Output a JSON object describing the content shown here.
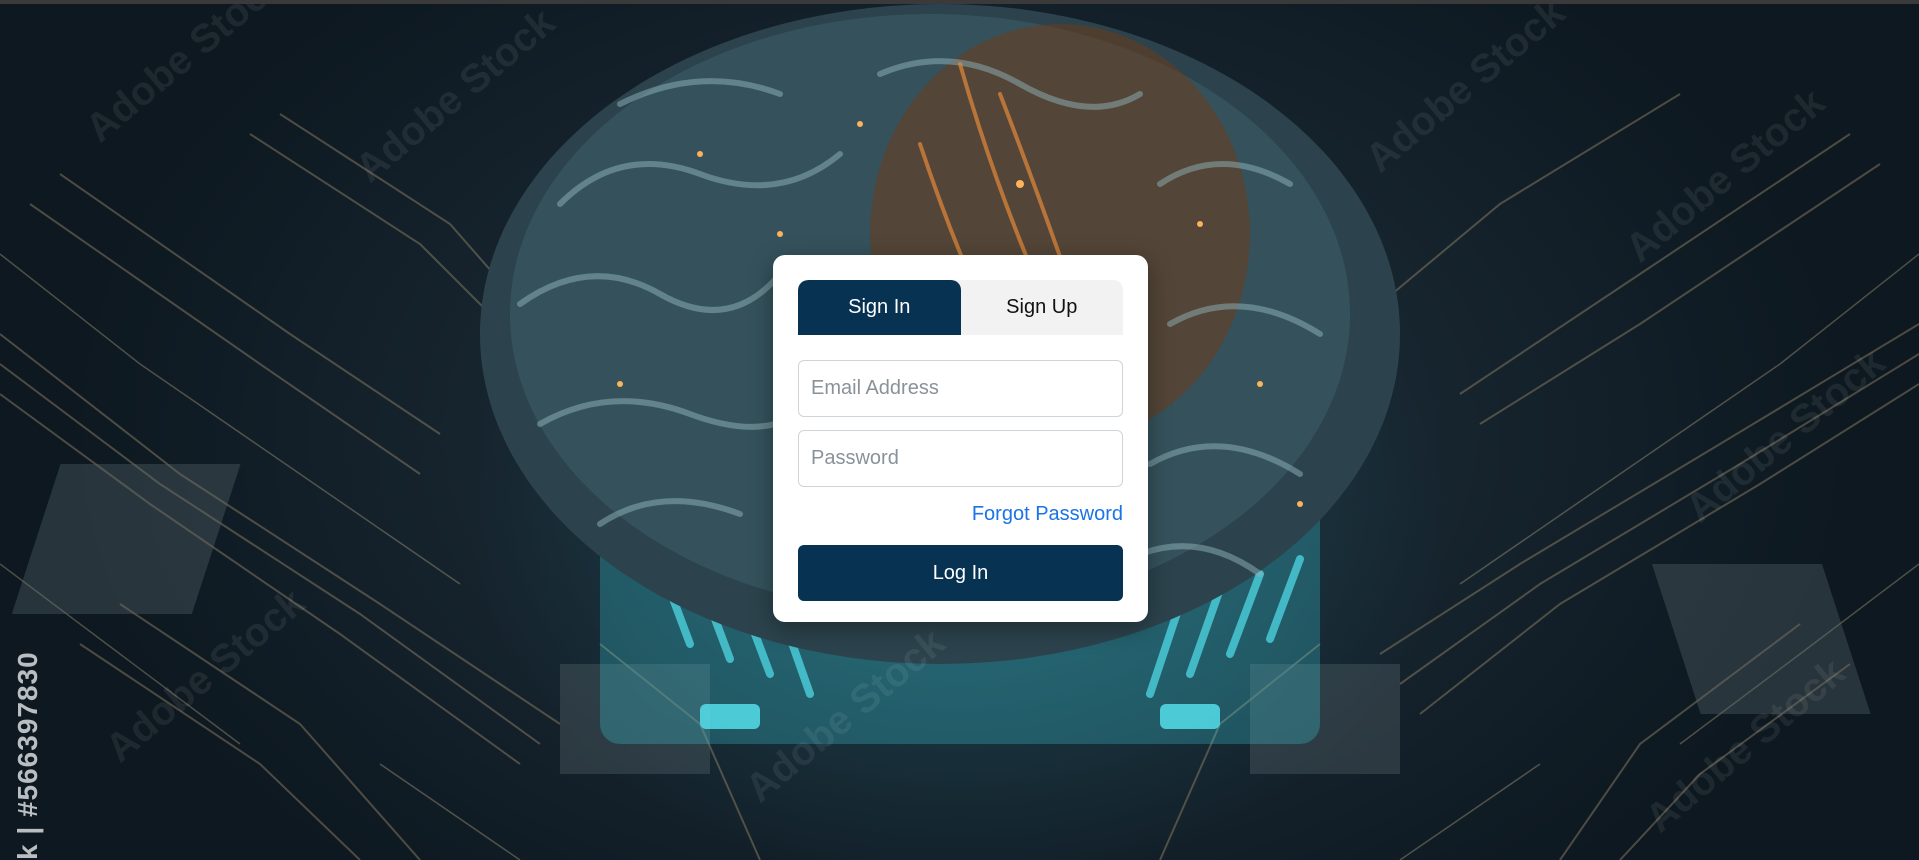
{
  "watermark": {
    "side_text": "k | #566397830",
    "repeated_text": "Adobe Stock"
  },
  "auth_card": {
    "tabs": [
      {
        "label": "Sign In",
        "active": true
      },
      {
        "label": "Sign Up",
        "active": false
      }
    ],
    "email_placeholder": "Email Address",
    "password_placeholder": "Password",
    "forgot_label": "Forgot Password",
    "login_label": "Log In"
  },
  "colors": {
    "primary": "#083252",
    "link": "#1a73e8",
    "tab_inactive_bg": "#f2f2f2"
  }
}
